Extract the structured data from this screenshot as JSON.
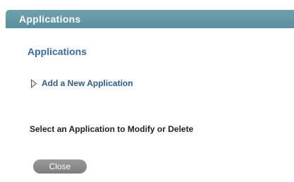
{
  "header": {
    "title": "Applications"
  },
  "main": {
    "section_title": "Applications",
    "add_link_label": "Add a New Application",
    "add_link_icon": "triangle-right-icon",
    "instruction": "Select an Application to Modify or Delete",
    "close_label": "Close"
  },
  "colors": {
    "header_bar": "#5f94a2",
    "header_text": "#ffffff",
    "section_title": "#3a6ba6",
    "link_text": "#2d5a8c",
    "body_text": "#222222",
    "close_button": "#8a8a8a"
  }
}
